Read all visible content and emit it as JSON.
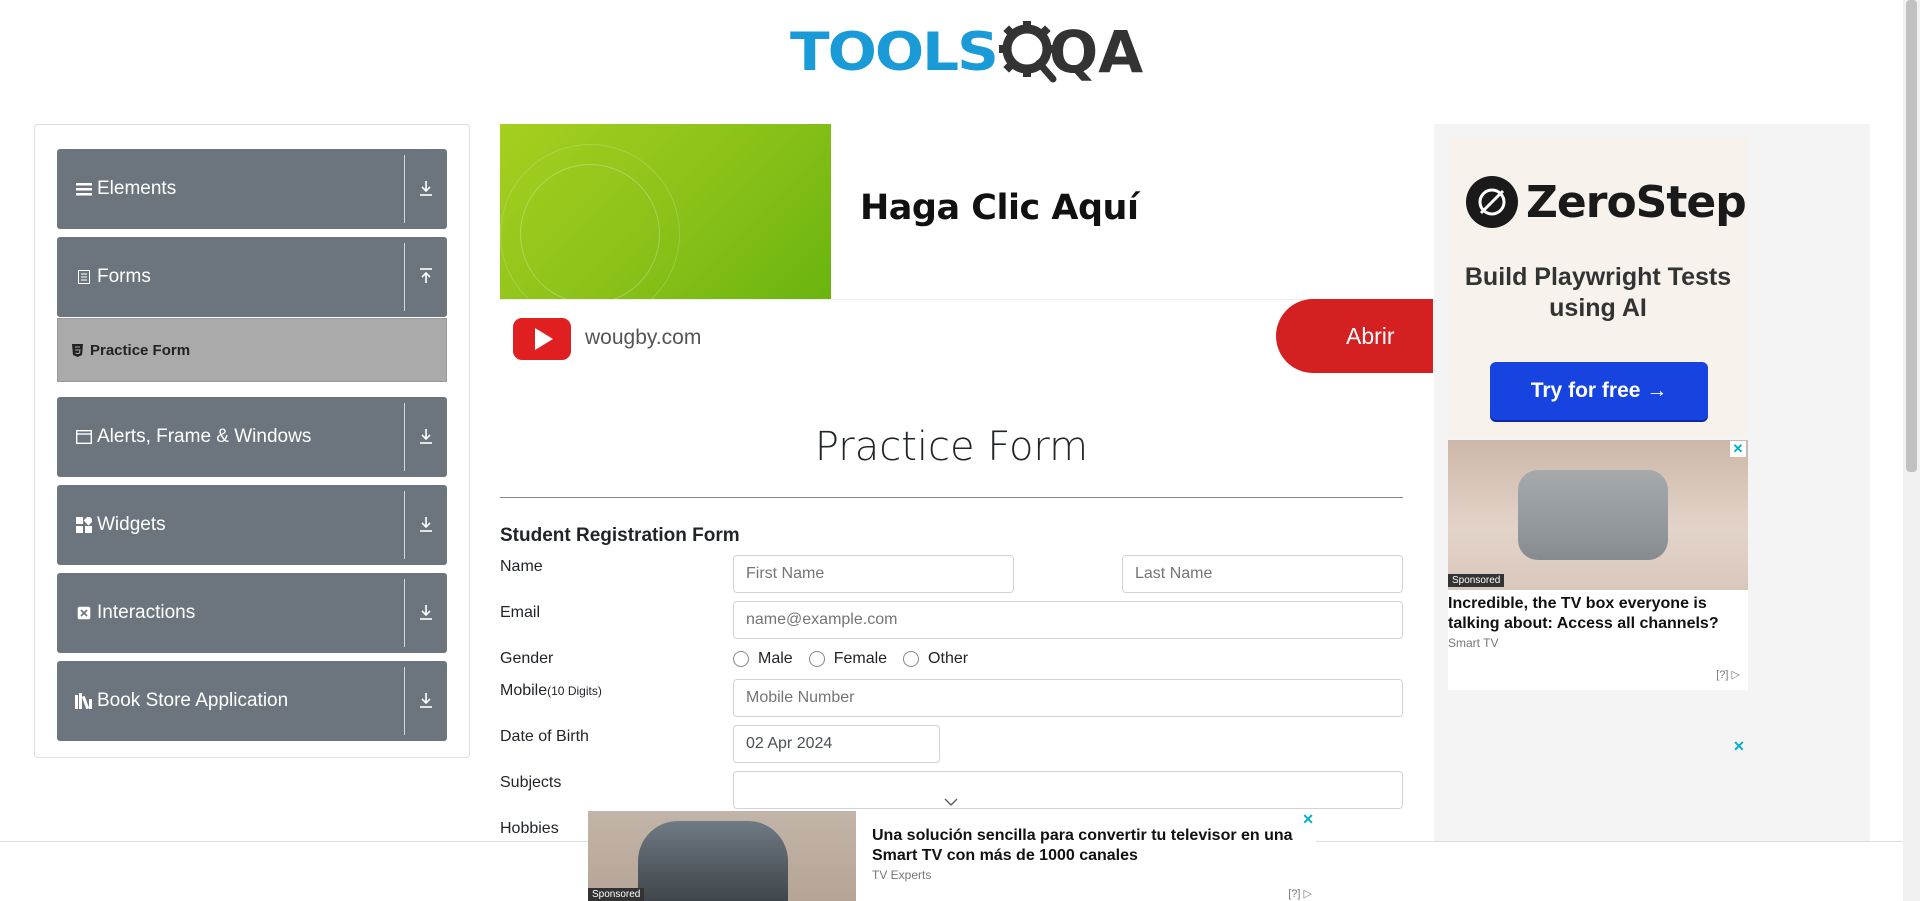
{
  "logo": {
    "part1": "TOOLS",
    "part2": "QA"
  },
  "sidebar": {
    "groups": [
      {
        "label": "Elements",
        "icon": "hamburger-icon",
        "arrow": "download-arrow"
      },
      {
        "label": "Forms",
        "icon": "form-icon",
        "arrow": "upload-arrow"
      },
      {
        "label": "Alerts, Frame & Windows",
        "icon": "window-icon",
        "arrow": "download-arrow"
      },
      {
        "label": "Widgets",
        "icon": "widgets-icon",
        "arrow": "download-arrow"
      },
      {
        "label": "Interactions",
        "icon": "interactions-icon",
        "arrow": "download-arrow"
      },
      {
        "label": "Book Store Application",
        "icon": "books-icon",
        "arrow": "download-arrow"
      }
    ],
    "active_item": "Practice Form"
  },
  "ad_top": {
    "headline": "Haga Clic Aquí",
    "domain": "wougby.com",
    "button": "Abrir"
  },
  "form": {
    "title": "Practice Form",
    "subtitle": "Student Registration Form",
    "labels": {
      "name": "Name",
      "email": "Email",
      "gender": "Gender",
      "mobile": "Mobile",
      "mobile_hint": "(10 Digits)",
      "dob": "Date of Birth",
      "subjects": "Subjects",
      "hobbies": "Hobbies"
    },
    "placeholders": {
      "first_name": "First Name",
      "last_name": "Last Name",
      "email": "name@example.com",
      "mobile": "Mobile Number"
    },
    "dob_value": "02 Apr 2024",
    "gender_options": [
      "Male",
      "Female",
      "Other"
    ]
  },
  "ad_right": {
    "brand": "ZeroStep",
    "tagline": "Build Playwright Tests using AI",
    "cta": "Try for free →",
    "promo_label": "Sponsored",
    "promo_title": "Incredible, the TV box everyone is talking about: Access all channels?",
    "promo_source": "Smart TV",
    "adinfo": "[?]"
  },
  "ad_bottom": {
    "label": "Sponsored",
    "title": "Una solución sencilla para convertir tu televisor en una Smart TV con más de 1000 canales",
    "source": "TV Experts",
    "adinfo": "[?]"
  },
  "colors": {
    "sidebar_bg": "#6c757d",
    "active_item_bg": "#aaaaaa",
    "brand_blue": "#1a9bd7",
    "ad_red": "#d42020",
    "cta_blue": "#1744e0"
  }
}
